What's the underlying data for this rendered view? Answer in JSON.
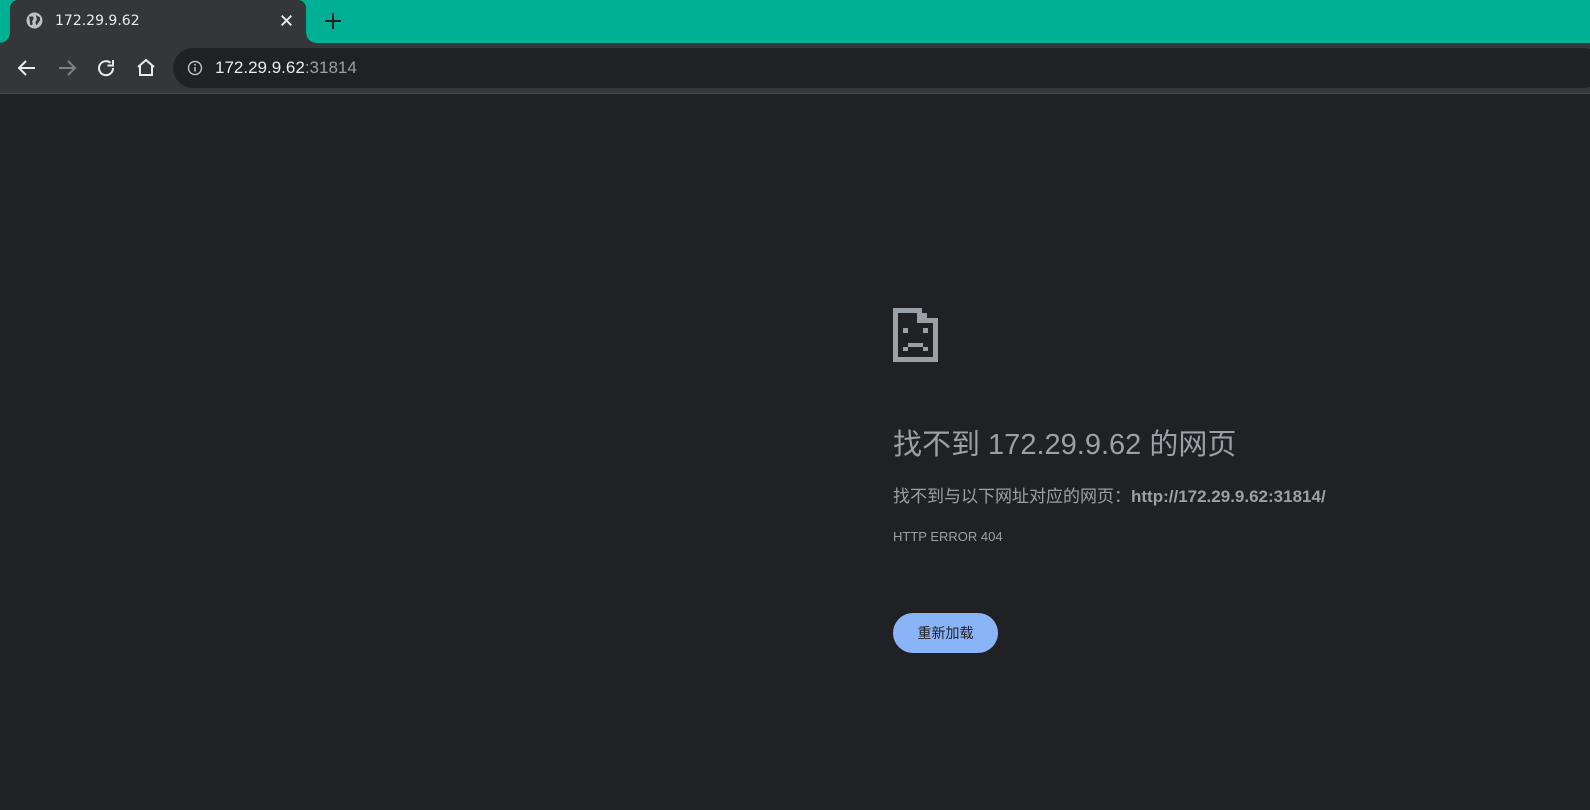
{
  "tab": {
    "title": "172.29.9.62",
    "favicon": "globe-icon"
  },
  "toolbar": {
    "back_icon": "arrow-left-icon",
    "forward_icon": "arrow-right-icon",
    "reload_icon": "reload-icon",
    "home_icon": "home-icon"
  },
  "omnibox": {
    "host": "172.29.9.62",
    "rest": ":31814",
    "icon": "info-icon"
  },
  "error_page": {
    "icon": "sad-page-icon",
    "title": "找不到 172.29.9.62 的网页",
    "desc_prefix": "找不到与以下网址对应的网页：",
    "desc_url": "http://172.29.9.62:31814/",
    "error_code": "HTTP ERROR 404",
    "reload_label": "重新加载"
  },
  "colors": {
    "tabstrip": "#00b095",
    "toolbar": "#35363a",
    "page_bg": "#202124",
    "button": "#8ab4f8"
  }
}
